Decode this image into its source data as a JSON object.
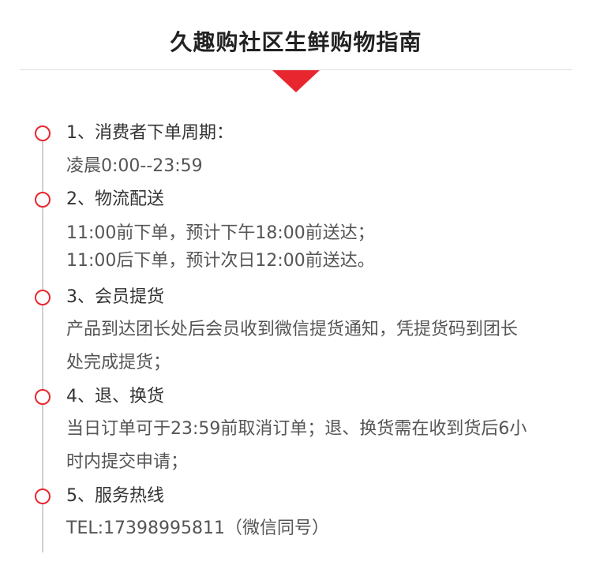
{
  "title": "久趣购社区生鲜购物指南",
  "sections": [
    {
      "heading": "1、消费者下单周期：",
      "lines": [
        "凌晨0:00--23:59"
      ]
    },
    {
      "heading": "2、物流配送",
      "lines": [
        "11:00前下单，预计下午18:00前送达；",
        "11:00后下单，预计次日12:00前送达。"
      ]
    },
    {
      "heading": "3、会员提货",
      "lines": [
        "产品到达团长处后会员收到微信提货通知，凭提货码到团长",
        "处完成提货；"
      ]
    },
    {
      "heading": "4、退、换货",
      "lines": [
        "当日订单可于23:59前取消订单；退、换货需在收到货后6小",
        "时内提交申请；"
      ]
    },
    {
      "heading": "5、服务热线",
      "lines": [
        "TEL:17398995811（微信同号）"
      ]
    }
  ],
  "colors": {
    "accent": "#e8262f",
    "divider": "#dedede",
    "timeline": "#cfcfcf"
  }
}
